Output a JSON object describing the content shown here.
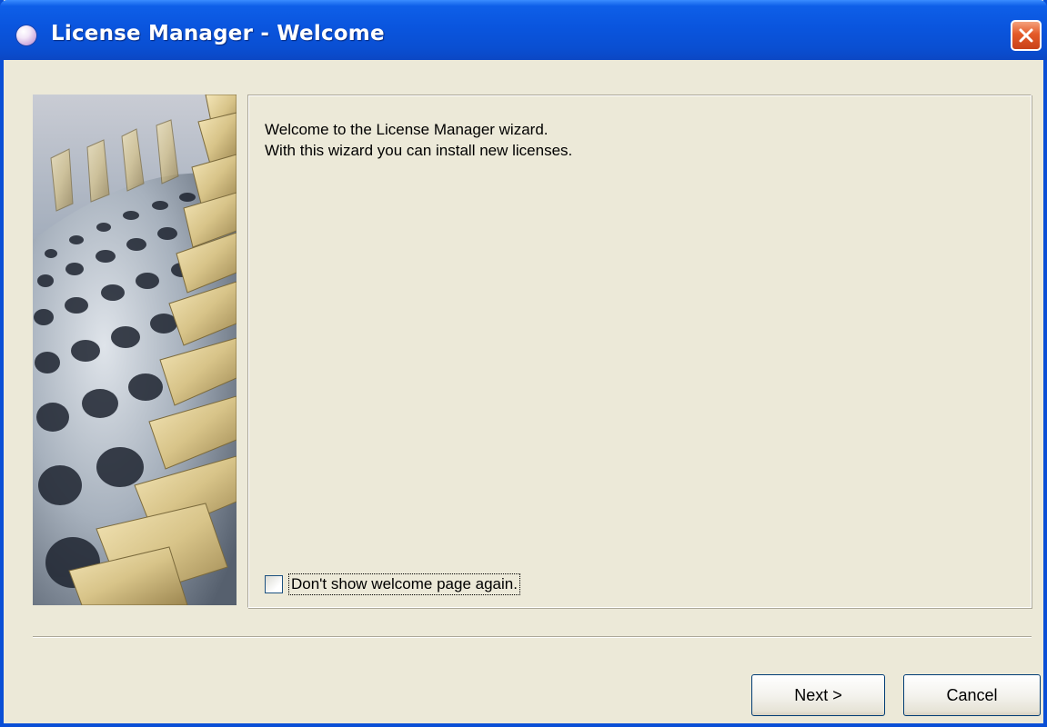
{
  "window": {
    "title": "License Manager - Welcome"
  },
  "content": {
    "welcome_line1": "Welcome to the License Manager wizard.",
    "welcome_line2": "With this wizard you can install new licenses.",
    "dont_show_label": "Don't show welcome page again.",
    "dont_show_checked": false
  },
  "buttons": {
    "next_label": "Next >",
    "cancel_label": "Cancel"
  },
  "colors": {
    "titlebar": "#0a55de",
    "window_bg": "#ece9d8",
    "close_button": "#e45a28",
    "gold_ornament": "#d8c489"
  }
}
